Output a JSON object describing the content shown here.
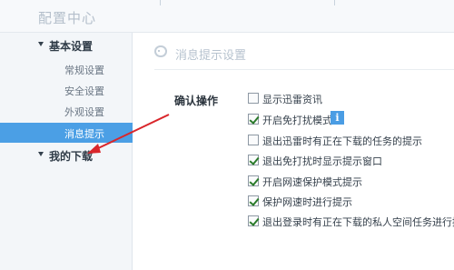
{
  "app": {
    "title": "配置中心"
  },
  "sidebar": {
    "groups": [
      {
        "label": "基本设置",
        "items": [
          {
            "label": "常规设置"
          },
          {
            "label": "安全设置"
          },
          {
            "label": "外观设置"
          },
          {
            "label": "消息提示",
            "active": true
          }
        ]
      },
      {
        "label": "我的下载",
        "items": []
      }
    ]
  },
  "main": {
    "section_title": "消息提示设置",
    "row_label": "确认操作",
    "options": [
      {
        "label": "显示迅雷资讯",
        "checked": false
      },
      {
        "label": "开启免打扰模式",
        "checked": true
      },
      {
        "label": "退出迅雷时有正在下载的任务的提示",
        "checked": false
      },
      {
        "label": "退出免打扰时显示提示窗口",
        "checked": true
      },
      {
        "label": "开启网速保护模式提示",
        "checked": true
      },
      {
        "label": "保护网速时进行提示",
        "checked": true
      },
      {
        "label": "退出登录时有正在下载的私人空间任务进行提示",
        "checked": true
      }
    ]
  },
  "colors": {
    "accent": "#4b9fe5",
    "annotation_arrow": "#d9262b"
  },
  "icons": {
    "info": "info-icon",
    "section": "speech-bubble-icon"
  }
}
